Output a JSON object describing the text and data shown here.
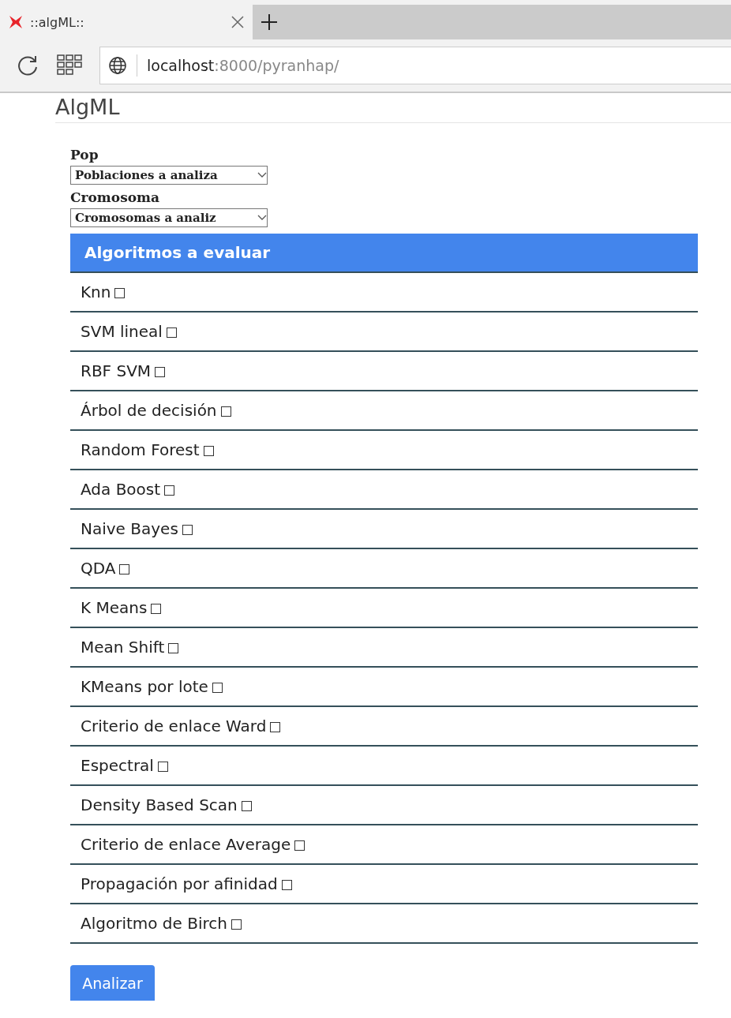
{
  "browser": {
    "tab": {
      "title": "::algML::",
      "selected": true
    },
    "address": {
      "host": "localhost",
      "rest": ":8000/pyranhap/"
    }
  },
  "page": {
    "brand": "AlgML"
  },
  "form": {
    "fields": [
      {
        "label": "Pop",
        "value": "Poblaciones a analiza"
      },
      {
        "label": "Cromosoma",
        "value": "Cromosomas a analiz"
      }
    ],
    "panel": {
      "title": "Algoritmos a evaluar",
      "items": [
        {
          "label": "Knn",
          "checked": false
        },
        {
          "label": "SVM lineal",
          "checked": false
        },
        {
          "label": "RBF SVM",
          "checked": false
        },
        {
          "label": "Árbol de decisión",
          "checked": false
        },
        {
          "label": "Random Forest",
          "checked": false
        },
        {
          "label": "Ada Boost",
          "checked": false
        },
        {
          "label": "Naive Bayes",
          "checked": false
        },
        {
          "label": "QDA",
          "checked": false
        },
        {
          "label": "K Means",
          "checked": false
        },
        {
          "label": "Mean Shift",
          "checked": false
        },
        {
          "label": "KMeans por lote",
          "checked": false
        },
        {
          "label": "Criterio de enlace Ward",
          "checked": false
        },
        {
          "label": "Espectral",
          "checked": false
        },
        {
          "label": "Density Based Scan",
          "checked": false
        },
        {
          "label": "Criterio de enlace Average",
          "checked": false
        },
        {
          "label": "Propagación por afinidad",
          "checked": false
        },
        {
          "label": "Algoritmo de Birch",
          "checked": false
        }
      ]
    },
    "submit": "Analizar"
  }
}
